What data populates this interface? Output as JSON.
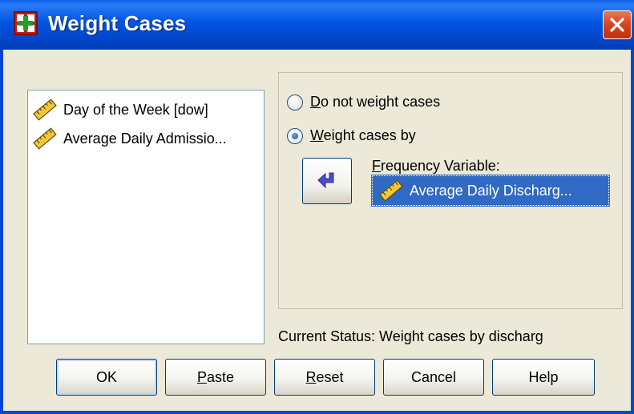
{
  "window": {
    "title": "Weight Cases",
    "title_icon": "spss-table-icon",
    "close_icon": "close-icon"
  },
  "variable_list": {
    "items": [
      {
        "label": "Day of the Week [dow]",
        "icon": "scale-ruler-icon"
      },
      {
        "label": "Average Daily Admissio...",
        "icon": "scale-ruler-icon"
      }
    ]
  },
  "options": {
    "do_not_weight": {
      "mnemonic": "D",
      "rest": "o not weight cases",
      "selected": false
    },
    "weight_by": {
      "mnemonic": "W",
      "rest": "eight cases by",
      "selected": true
    }
  },
  "frequency": {
    "label_mnemonic": "F",
    "label_rest": "requency Variable:",
    "value": "Average Daily Discharg...",
    "icon": "scale-ruler-icon",
    "move_button_icon": "arrow-left-icon"
  },
  "status": {
    "text": "Current Status: Weight cases by discharg"
  },
  "buttons": {
    "ok": "OK",
    "paste_mnemonic": "P",
    "paste_rest": "aste",
    "reset_mnemonic": "R",
    "reset_rest": "eset",
    "cancel": "Cancel",
    "help": "Help"
  },
  "colors": {
    "titlebar": "#0054e3",
    "selection": "#316ac5",
    "dialog_bg": "#ece9d8"
  }
}
